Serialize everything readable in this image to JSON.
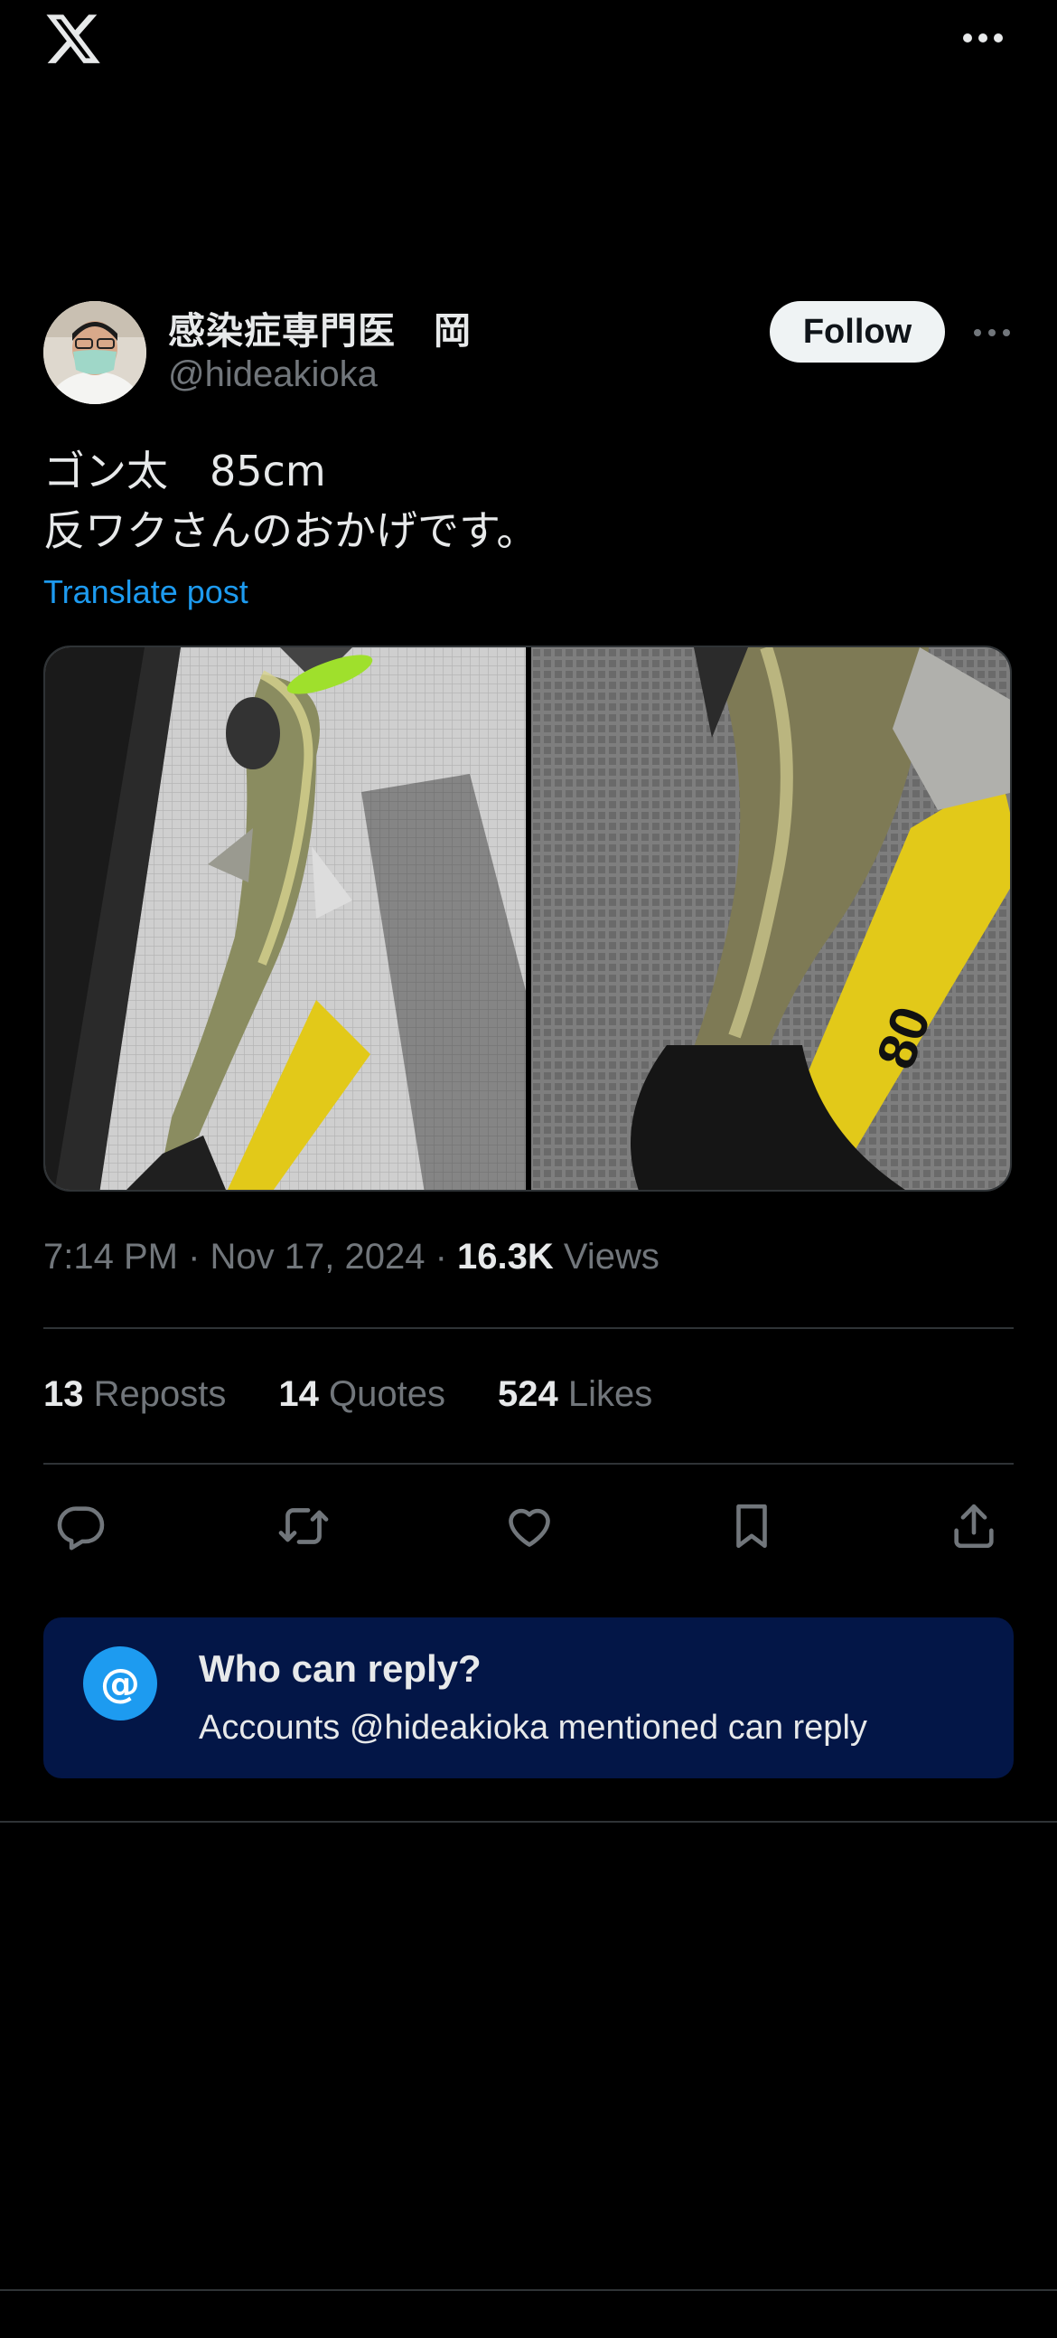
{
  "top_bar": {
    "logo_icon": "x-logo-icon",
    "more_icon": "more-horizontal-icon"
  },
  "author": {
    "display_name": "感染症専門医　岡",
    "handle": "@hideakioka",
    "follow_label": "Follow"
  },
  "post": {
    "text": "ゴン太　85cm\n反ワクさんのおかげです。",
    "translate_label": "Translate post",
    "media": [
      {
        "description_icon": "photo-fish-with-measure-left"
      },
      {
        "description_icon": "photo-fish-with-measure-right"
      }
    ]
  },
  "meta": {
    "time": "7:14 PM",
    "date": "Nov 17, 2024",
    "separator": " · ",
    "views_count": "16.3K",
    "views_label": "Views"
  },
  "stats": {
    "reposts_count": "13",
    "reposts_label": "Reposts",
    "quotes_count": "14",
    "quotes_label": "Quotes",
    "likes_count": "524",
    "likes_label": "Likes"
  },
  "actions": [
    "reply-icon",
    "repost-icon",
    "like-icon",
    "bookmark-icon",
    "share-icon"
  ],
  "reply_restriction": {
    "title": "Who can reply?",
    "subtitle": "Accounts @hideakioka mentioned can reply",
    "icon_glyph": "@"
  },
  "colors": {
    "background": "#000000",
    "accent": "#1d9bf0",
    "muted_text": "#71767b",
    "reply_card_bg": "#031647"
  }
}
